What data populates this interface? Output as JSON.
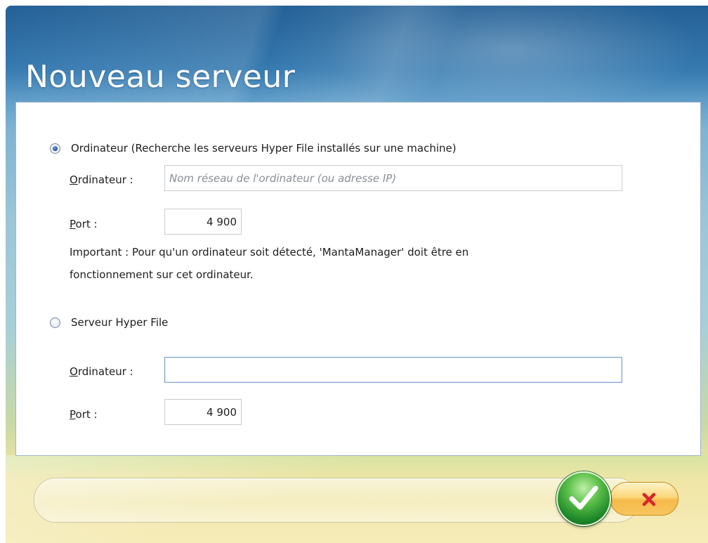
{
  "window": {
    "title": "Nouveau serveur"
  },
  "option_computer": {
    "label": "Ordinateur (Recherche les serveurs Hyper File installés sur une machine)",
    "selected": true,
    "computer_label_prefix": "O",
    "computer_label_rest": "rdinateur :",
    "computer_placeholder": "Nom réseau de l'ordinateur (ou adresse IP)",
    "computer_value": "",
    "port_label_prefix": "P",
    "port_label_rest": "ort :",
    "port_value": "4 900",
    "note_line1": "Important : Pour qu'un ordinateur soit détecté, 'MantaManager' doit être en",
    "note_line2": "fonctionnement sur cet ordinateur."
  },
  "option_server": {
    "label": "Serveur Hyper File",
    "selected": false,
    "computer_label_prefix": "O",
    "computer_label_rest": "rdinateur :",
    "computer_value": "",
    "port_label_prefix": "P",
    "port_label_rest": "ort :",
    "port_value": "4 900"
  },
  "buttons": {
    "ok_icon": "checkmark-icon",
    "cancel_icon": "close-icon"
  },
  "colors": {
    "ok_green": "#1f8a2a",
    "cancel_orange": "#f5b94a",
    "cancel_x_red": "#d8252a"
  }
}
